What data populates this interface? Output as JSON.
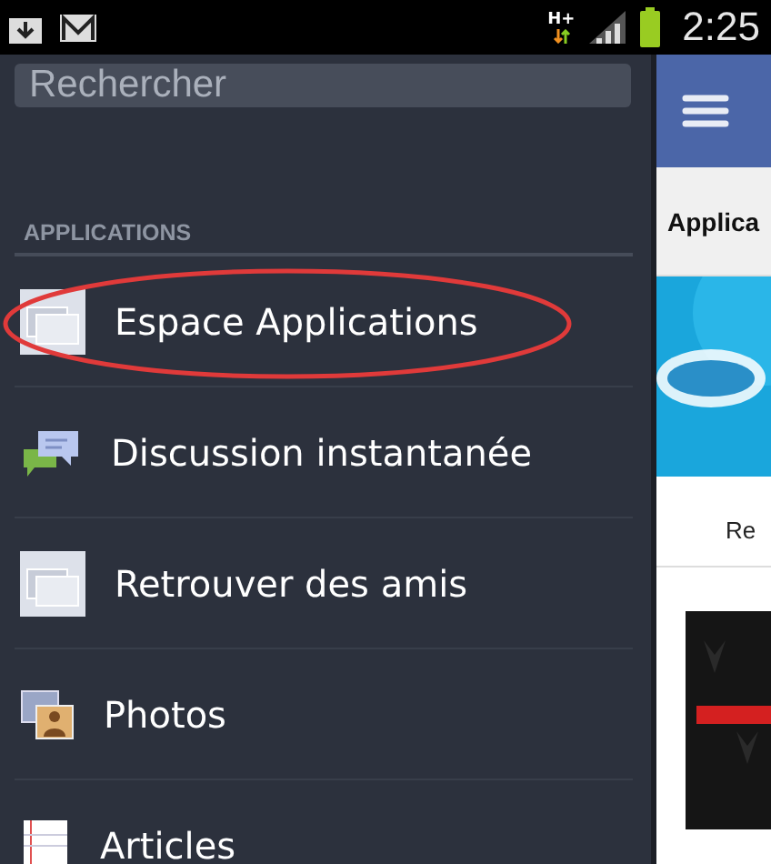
{
  "status_bar": {
    "time": "2:25",
    "network": "H+"
  },
  "search": {
    "placeholder": "Rechercher"
  },
  "section": {
    "title": "APPLICATIONS"
  },
  "items": [
    {
      "label": "Espace Applications",
      "kind": "apps",
      "circled": true
    },
    {
      "label": "Discussion instantanée",
      "kind": "chat",
      "circled": false
    },
    {
      "label": "Retrouver des amis",
      "kind": "apps",
      "circled": false
    },
    {
      "label": "Photos",
      "kind": "photos",
      "circled": false
    },
    {
      "label": "Articles",
      "kind": "notes",
      "circled": false
    }
  ],
  "main": {
    "tab_label": "Applica",
    "caption": "Re"
  }
}
